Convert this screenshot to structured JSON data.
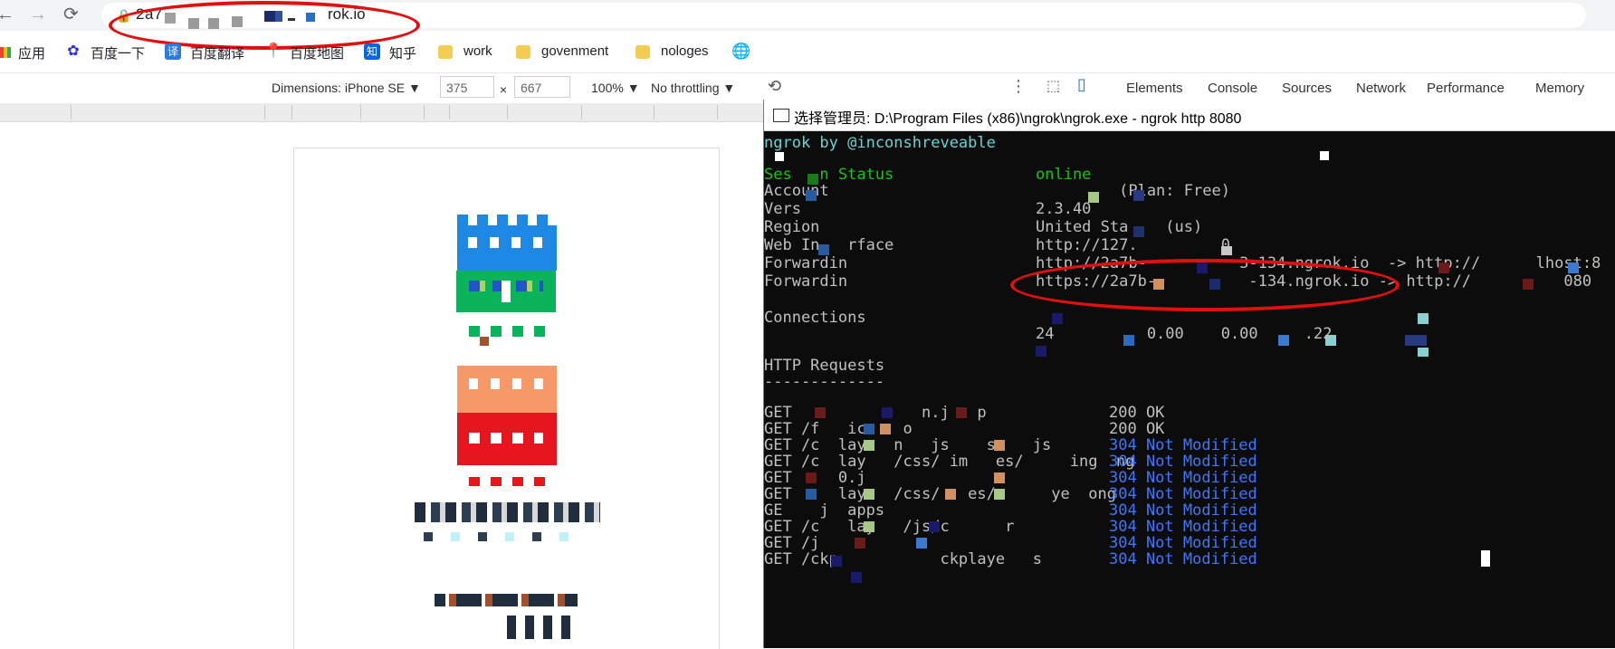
{
  "browser": {
    "url_visible_start": "2a7",
    "url_visible_end": "rok.io",
    "nav": {
      "back_icon": "back-arrow-icon",
      "forward_icon": "forward-arrow-icon",
      "reload_icon": "reload-icon"
    }
  },
  "bookmarks": [
    {
      "label": "应用",
      "icon": "apps-grid-icon"
    },
    {
      "label": "百度一下",
      "icon": "baidu-paw-icon"
    },
    {
      "label": "百度翻译",
      "icon": "baidu-translate-icon"
    },
    {
      "label": "百度地图",
      "icon": "baidu-map-pin-icon"
    },
    {
      "label": "知乎",
      "icon": "zhihu-icon"
    },
    {
      "label": "work",
      "icon": "folder-icon"
    },
    {
      "label": "govenment",
      "icon": "folder-icon"
    },
    {
      "label": "nologes",
      "icon": "folder-icon"
    },
    {
      "label": "",
      "icon": "globe-icon"
    }
  ],
  "device_toolbar": {
    "dimensions_label": "Dimensions: iPhone SE ▼",
    "width": "375",
    "times": "×",
    "height": "667",
    "zoom": "100% ▼",
    "throttling": "No throttling ▼"
  },
  "devtools_tabs": [
    "Elements",
    "Console",
    "Sources",
    "Network",
    "Performance",
    "Memory"
  ],
  "terminal": {
    "title": "选择管理员: D:\\Program Files (x86)\\ngrok\\ngrok.exe - ngrok  http 8080",
    "banner": "ngrok by @inconshreveable",
    "rows": [
      {
        "label": "Ses   n Status",
        "value": "online"
      },
      {
        "label": "Account",
        "value": "         (Plan: Free)"
      },
      {
        "label": "Vers",
        "value": "2.3.40"
      },
      {
        "label": "Region",
        "value": "United Sta    (us)"
      },
      {
        "label": "Web In   rface",
        "value": "http://127.         0"
      },
      {
        "label": "Forwardin",
        "value": "http://2a7b-          3-134.ngrok.io  -> http://      lhost:8"
      },
      {
        "label": "Forwardin",
        "value": "https://2a7b-          -134.ngrok.io -> http://          080"
      }
    ],
    "connections_label": "Connections",
    "requests_header": "HTTP Requests",
    "requests_rule": "-------------",
    "requests": [
      {
        "req": "GET          -   n.j   p",
        "status": "200 OK"
      },
      {
        "req": "GET /f   ico   o",
        "status": "200 OK"
      },
      {
        "req": "GET /c  lay   n   js    s.   js",
        "status": "304 Not Modified"
      },
      {
        "req": "GET /c  lay   /css/ im   es/     ing  ng",
        "status": "304 Not Modified"
      },
      {
        "req": "GET     0.j",
        "status": "304 Not Modified"
      },
      {
        "req": "GET     lay   /css/   es/c     ye  ong",
        "status": "304 Not Modified"
      },
      {
        "req": "GE    j  apps",
        "status": "304 Not Modified"
      },
      {
        "req": "GET /c   lay   /js/c      r",
        "status": "304 Not Modified"
      },
      {
        "req": "GET /j",
        "status": "304 Not Modified"
      },
      {
        "req": "GET /ckp           ckplaye   s",
        "status": "304 Not Modified"
      }
    ]
  },
  "colors": {
    "annotation_red": "#e01010",
    "terminal_bg": "#0c0c0c",
    "ok_blue": "#3b78ff"
  }
}
